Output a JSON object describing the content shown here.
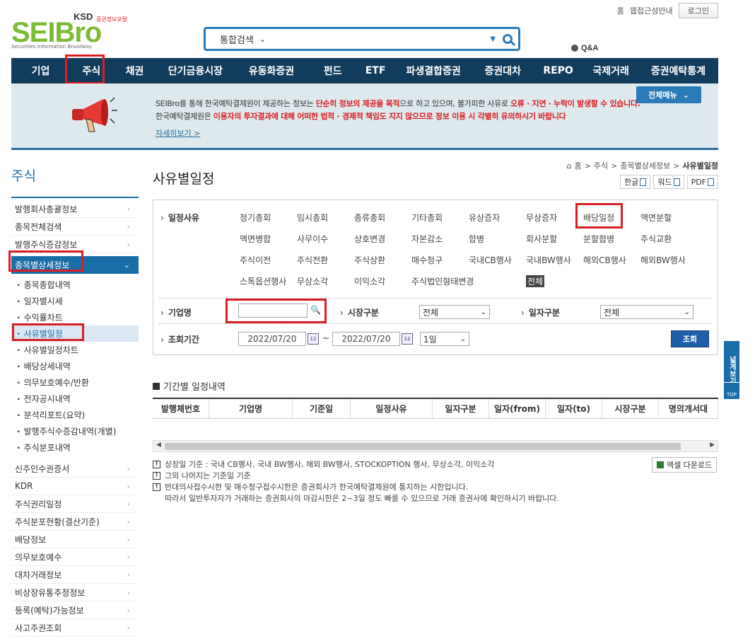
{
  "header": {
    "logo_main": "SEIBro",
    "logo_ksd": "KSD",
    "logo_portal": "증권정보포털",
    "logo_sub": "Securities Information Broadway",
    "home": "홈",
    "accessibility": "웹접근성안내",
    "login": "로그인",
    "search_scope": "통합검색",
    "qna": "Q&A"
  },
  "nav": [
    "기업",
    "주식",
    "채권",
    "단기금융시장",
    "유동화증권",
    "펀드",
    "ETF",
    "파생결합증권",
    "증권대차",
    "REPO",
    "국제거래",
    "증권예탁통계"
  ],
  "banner": {
    "l1a": "SEIBro를 통해 한국예탁결제원이 제공하는 정보는 ",
    "l1b": "단순히 정보의 제공을 목적",
    "l1c": "으로 하고 있으며, 불가피한 사유로 ",
    "l1d": "오류 · 지연 · 누락이 발생할 수 있습니다.",
    "l2a": "한국예탁결제원은 ",
    "l2b": "이용자의 투자결과에 대해 어떠한 법적 · 경제적 책임도 지지 않으므로 정보 이용 시 각별히 유의하시기 바랍니다",
    "more": "자세히보기 >",
    "full_menu": "전체메뉴"
  },
  "sidebar": {
    "title": "주식",
    "top_items": [
      "발행회사총괄정보",
      "종목전체검색",
      "발행주식증감정보"
    ],
    "active": "종목별상세정보",
    "subs": [
      "종목종합내역",
      "일자별시세",
      "수익률차트",
      "사유별일정",
      "사유별일정차트",
      "배당상세내역",
      "의무보호예수/반환",
      "전자공시내역",
      "분석리포트(요약)",
      "발행주식수증감내역(개별)",
      "주식분포내역"
    ],
    "bottom_items": [
      "신주인수권증서",
      "KDR",
      "주식권리일정",
      "주식분포현황(결산기준)",
      "배당정보",
      "의무보호예수",
      "대차거래정보",
      "비상장유통추정정보",
      "등록(예탁)가능정보",
      "사고주권조회"
    ]
  },
  "main": {
    "title": "사유별일정",
    "breadcrumb": [
      "홈",
      "주식",
      "종목별상세정보",
      "사유별일정"
    ],
    "doc_buttons": [
      "한글",
      "워드",
      "PDF"
    ]
  },
  "filter": {
    "reason_label": "일정사유",
    "reasons": [
      [
        "정기총회",
        "임시총회",
        "종류총회",
        "기타총회",
        "유상증자",
        "무상증자",
        "배당일정",
        "액면분할"
      ],
      [
        "액면병합",
        "사무이수",
        "상호변경",
        "자본감소",
        "합병",
        "회사분할",
        "분할합병",
        "주식교환"
      ],
      [
        "주식이전",
        "주식전환",
        "주식상환",
        "매수청구",
        "국내CB행사",
        "국내BW행사",
        "해외CB행사",
        "해외BW행사"
      ],
      [
        "스톡옵션행사",
        "무상소각",
        "이익소각",
        "주식법인형태변경",
        "전체"
      ]
    ],
    "company_label": "기업명",
    "company_value": "",
    "market_label": "시장구분",
    "market_value": "전체",
    "date_type_label": "일자구분",
    "date_type_value": "전체",
    "period_label": "조회기간",
    "date_from": "2022/07/20",
    "date_to": "2022/07/20",
    "tilde": "~",
    "period_value": "1일",
    "search_button": "조회"
  },
  "results": {
    "title": "기간별 일정내역",
    "columns": [
      "발행체번호",
      "기업명",
      "기준일",
      "일정사유",
      "일자구분",
      "일자(from)",
      "일자(to)",
      "시장구분",
      "명의개서대"
    ]
  },
  "notes": [
    "상장일 기준 : 국내 CB행사, 국내 BW행사, 해외 BW행사, STOCKOPTION 행사, 무상소각, 이익소각",
    "그외 나머지는 기준일 기준",
    "반대의사접수시한 및 매수청구접수시한은 증권회사가 한국예탁결제원에 통지하는 시한입니다.",
    "따라서 일반투자자가 거래하는 증권회사의 마감시한은 2~3일 정도 빠를 수 있으므로 거래 증권사에 확인하시기 바랍니다."
  ],
  "excel_download": "엑셀 다운로드",
  "wide_view": "넓게보기",
  "top": "TOP"
}
